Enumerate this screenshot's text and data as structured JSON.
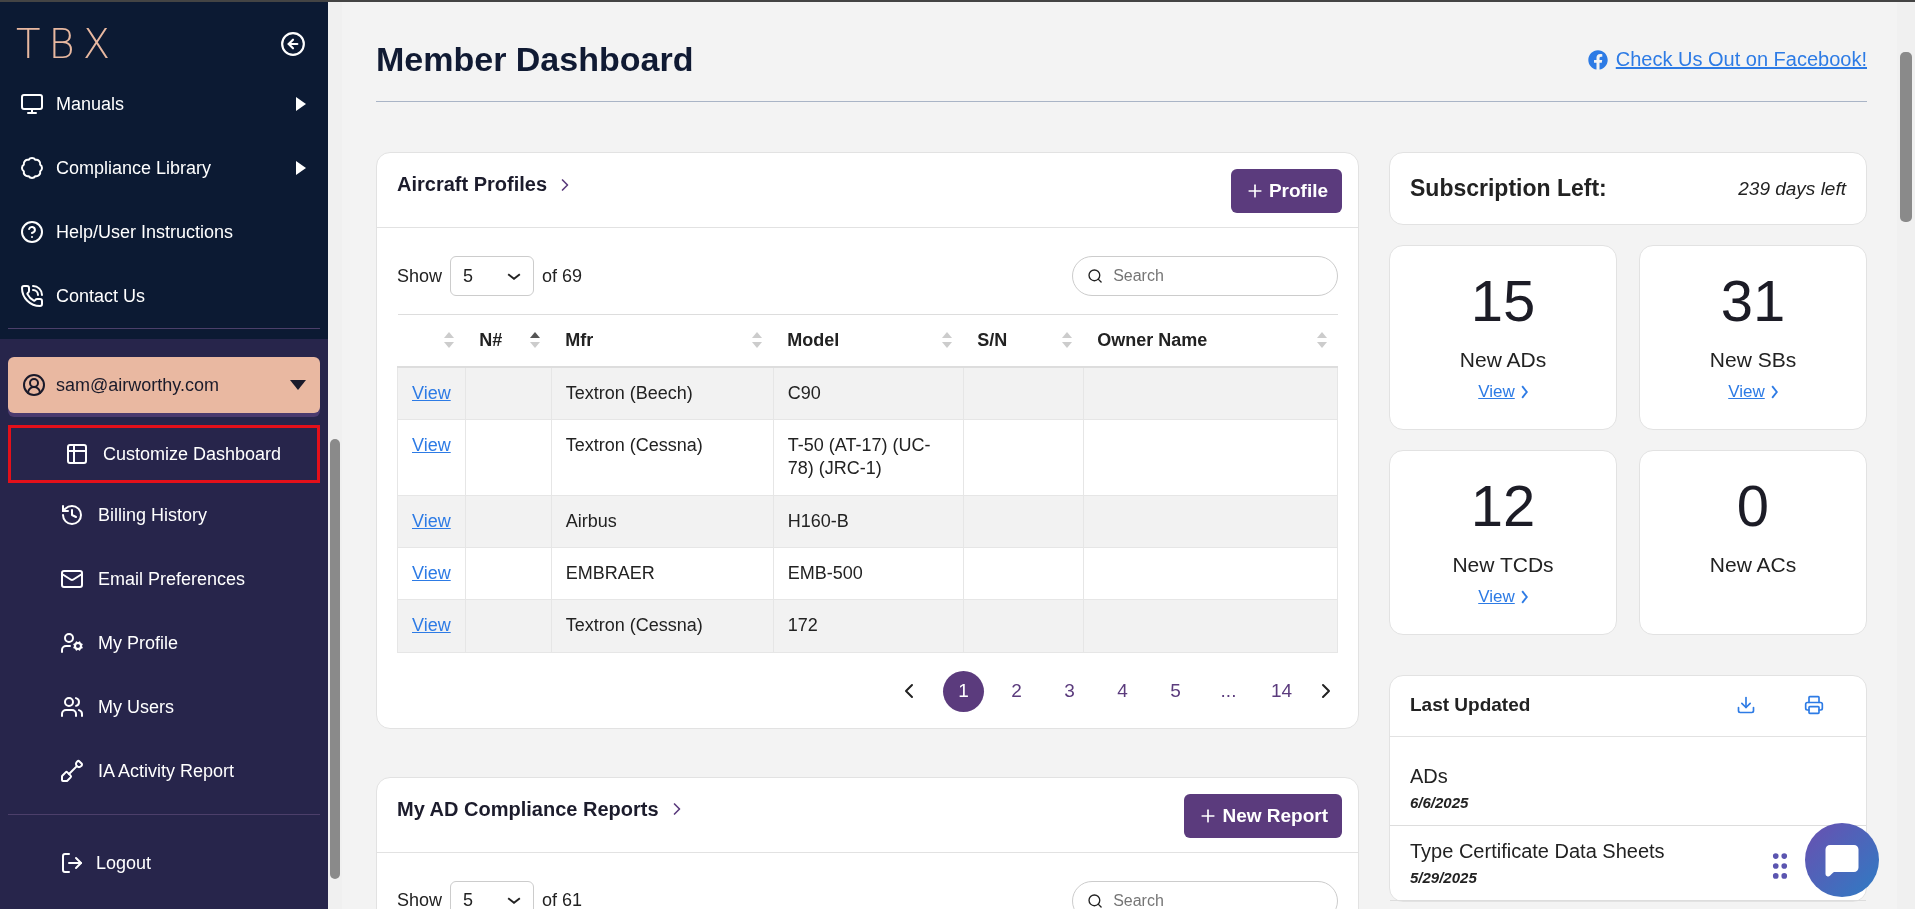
{
  "sidebar": {
    "logo": "TBX",
    "items": [
      {
        "label": "Manuals",
        "kind": "submenu"
      },
      {
        "label": "Compliance Library",
        "kind": "submenu"
      },
      {
        "label": "Help/User Instructions",
        "kind": "link"
      },
      {
        "label": "Contact Us",
        "kind": "link"
      }
    ],
    "user_menu": {
      "email": "sam@airworthy.com",
      "expanded": true,
      "items": [
        {
          "label": "Customize Dashboard",
          "selected": true
        },
        {
          "label": "Billing History",
          "selected": false
        },
        {
          "label": "Email Preferences",
          "selected": false
        },
        {
          "label": "My Profile",
          "selected": false
        },
        {
          "label": "My Users",
          "selected": false
        },
        {
          "label": "IA Activity Report",
          "selected": false
        }
      ]
    },
    "logout": "Logout"
  },
  "header": {
    "title": "Member Dashboard",
    "facebook_link": "Check Us Out on Facebook!"
  },
  "aircraft_profiles": {
    "title": "Aircraft Profiles",
    "button": "Profile",
    "show_label": "Show",
    "page_size": "5",
    "total": "of 69",
    "search": {
      "placeholder": "Search"
    },
    "columns": [
      {
        "sorted": false
      },
      {
        "label": "N#",
        "sorted": true
      },
      {
        "label": "Mfr",
        "sorted": false
      },
      {
        "label": "Model",
        "sorted": false
      },
      {
        "label": "S/N",
        "sorted": false
      },
      {
        "label": "Owner Name",
        "sorted": false
      }
    ],
    "rows": [
      {
        "action": "View",
        "mfr": "Textron (Beech)",
        "model": "C90"
      },
      {
        "action": "View",
        "mfr": "Textron (Cessna)",
        "model": "T-50 (AT-17) (UC-78) (JRC-1)"
      },
      {
        "action": "View",
        "mfr": "Airbus",
        "model": "H160-B"
      },
      {
        "action": "View",
        "mfr": "EMBRAER",
        "model": "EMB-500"
      },
      {
        "action": "View",
        "mfr": "Textron (Cessna)",
        "model": "172"
      }
    ],
    "pagination": [
      {
        "label": "1",
        "kind": "page",
        "selected": true
      },
      {
        "label": "2",
        "kind": "page",
        "selected": false
      },
      {
        "label": "3",
        "kind": "page",
        "selected": false
      },
      {
        "label": "4",
        "kind": "page",
        "selected": false
      },
      {
        "label": "5",
        "kind": "page",
        "selected": false
      },
      {
        "label": "...",
        "kind": "ellipsis"
      },
      {
        "label": "14",
        "kind": "page",
        "selected": false
      }
    ]
  },
  "compliance_reports": {
    "title": "My AD Compliance Reports",
    "button": "New Report",
    "show_label": "Show",
    "page_size": "5",
    "total": "of 61",
    "search": {
      "placeholder": "Search"
    }
  },
  "subscription": {
    "label": "Subscription Left:",
    "value": "239 days left"
  },
  "stats": [
    {
      "count": "15",
      "label": "New ADs",
      "link": "View"
    },
    {
      "count": "31",
      "label": "New SBs",
      "link": "View"
    },
    {
      "count": "12",
      "label": "New TCDs",
      "link": "View"
    },
    {
      "count": "0",
      "label": "New ACs"
    }
  ],
  "last_updated": {
    "title": "Last Updated",
    "entries": [
      {
        "name": "ADs",
        "date": "6/6/2025"
      },
      {
        "name": "Type Certificate Data Sheets",
        "date": "5/29/2025"
      }
    ]
  }
}
